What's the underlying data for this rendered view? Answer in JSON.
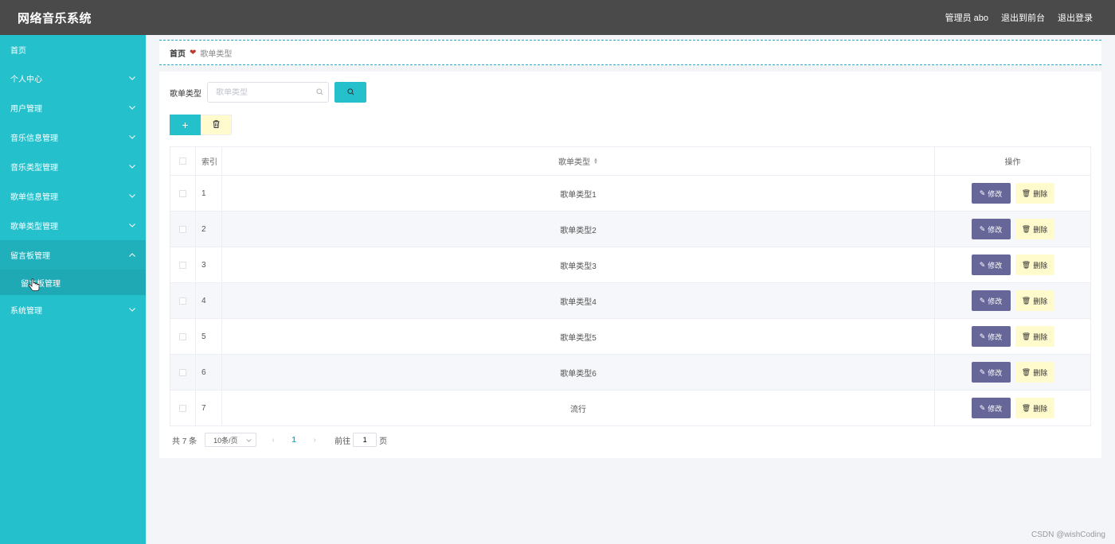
{
  "app": {
    "title": "网络音乐系统"
  },
  "topbar": {
    "admin_label": "管理员 abo",
    "to_front": "退出到前台",
    "logout": "退出登录"
  },
  "sidebar": {
    "items": [
      {
        "label": "首页"
      },
      {
        "label": "个人中心"
      },
      {
        "label": "用户管理"
      },
      {
        "label": "音乐信息管理"
      },
      {
        "label": "音乐类型管理"
      },
      {
        "label": "歌单信息管理"
      },
      {
        "label": "歌单类型管理"
      },
      {
        "label": "留言板管理"
      },
      {
        "label": "系统管理"
      }
    ],
    "sub_item": {
      "label": "留言板管理"
    }
  },
  "breadcrumb": {
    "home": "首页",
    "current": "歌单类型"
  },
  "search": {
    "label": "歌单类型",
    "placeholder": "歌单类型"
  },
  "table": {
    "headers": {
      "index": "索引",
      "name": "歌单类型",
      "ops": "操作"
    },
    "edit_label": "修改",
    "delete_label": "删除",
    "rows": [
      {
        "index": "1",
        "name": "歌单类型1"
      },
      {
        "index": "2",
        "name": "歌单类型2"
      },
      {
        "index": "3",
        "name": "歌单类型3"
      },
      {
        "index": "4",
        "name": "歌单类型4"
      },
      {
        "index": "5",
        "name": "歌单类型5"
      },
      {
        "index": "6",
        "name": "歌单类型6"
      },
      {
        "index": "7",
        "name": "流行"
      }
    ]
  },
  "pagination": {
    "total": "共 7 条",
    "page_size": "10条/页",
    "current_page": "1",
    "goto_label": "前往",
    "goto_value": "1",
    "page_suffix": "页"
  },
  "watermark": "CSDN @wishCoding",
  "colors": {
    "topbar": "#4a4a4a",
    "sidebar": "#24c0cc",
    "edit": "#666699",
    "delete": "#fffbcc"
  }
}
